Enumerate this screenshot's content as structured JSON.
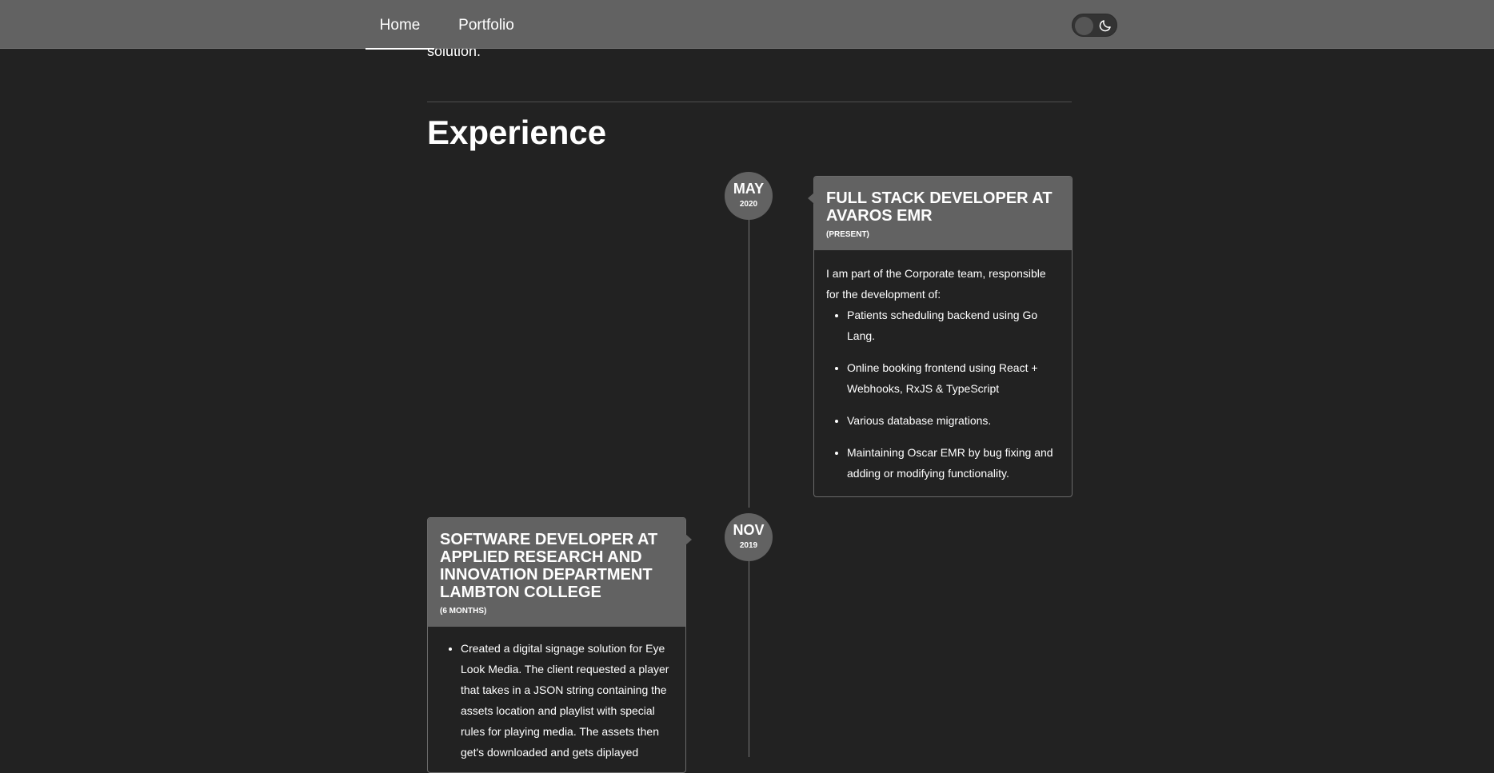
{
  "nav": {
    "home_label": "Home",
    "portfolio_label": "Portfolio"
  },
  "theme_toggle": {
    "icon": "moon-icon",
    "state": "dark"
  },
  "intro": {
    "tail_text": "solution."
  },
  "experience": {
    "heading": "Experience",
    "entries": [
      {
        "month": "MAY",
        "year": "2020",
        "title": "FULL STACK DEVELOPER AT AVAROS EMR",
        "duration": "(PRESENT)",
        "intro": "I am part of the Corporate team, responsible for the development of:",
        "bullets": [
          "Patients scheduling backend using Go Lang.",
          "Online booking frontend using React + Webhooks, RxJS & TypeScript",
          "Various database migrations.",
          "Maintaining Oscar EMR by bug fixing and adding or modifying functionality."
        ]
      },
      {
        "month": "NOV",
        "year": "2019",
        "title": "SOFTWARE DEVELOPER AT APPLIED RESEARCH AND INNOVATION DEPARTMENT LAMBTON COLLEGE",
        "duration": "(6 MONTHS)",
        "bullets": [
          "Created a digital signage solution for Eye Look Media. The client requested a player that takes in a JSON string containing the assets location and playlist with special rules for playing media. The assets then get's downloaded and gets diplayed"
        ]
      }
    ]
  },
  "colors": {
    "background": "#222222",
    "navbar": "#626262",
    "card_header": "#626262",
    "text": "#ffffff"
  }
}
